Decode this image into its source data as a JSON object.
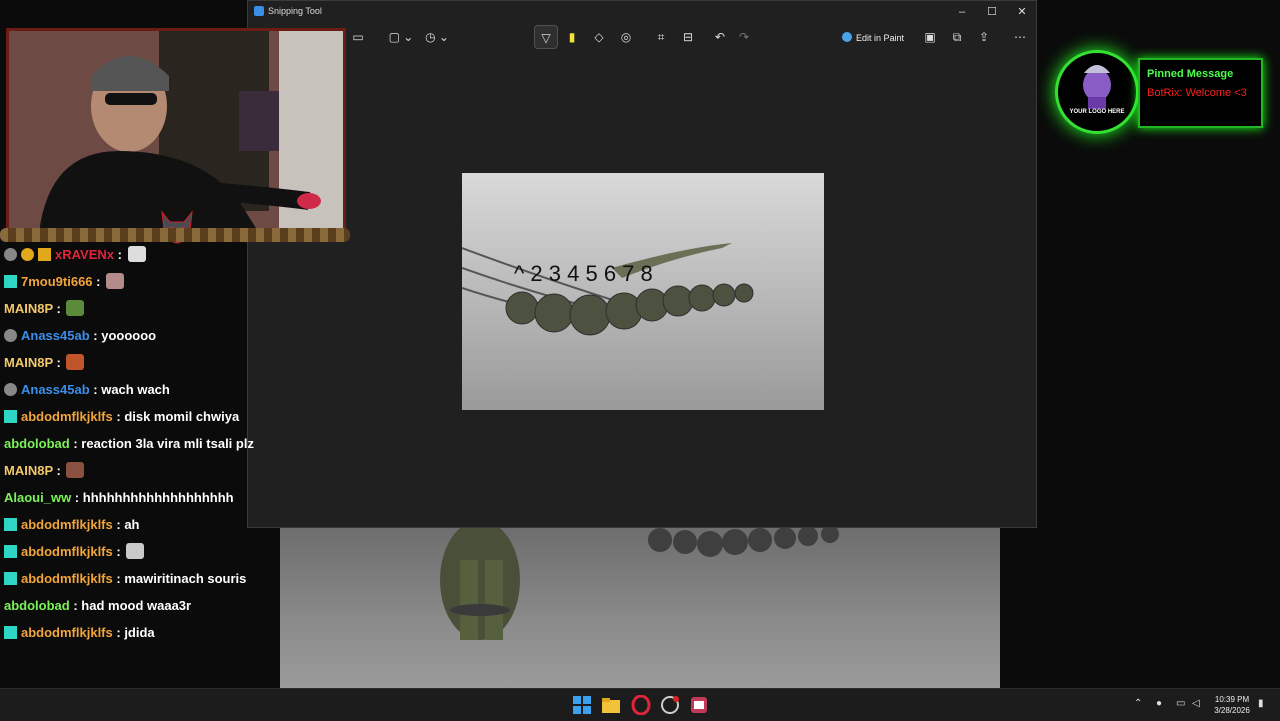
{
  "snipping_tool": {
    "title": "Snipping Tool",
    "edit_in_paint": "Edit in Paint",
    "canvas_annotation": "^ 2 3 4 5 6 7 8"
  },
  "pinned": {
    "logo_text": "YOUR LOGO HERE",
    "title": "Pinned Message",
    "text": "BotRix: Welcome <3"
  },
  "chat": {
    "messages": [
      {
        "user": "xRAVENx",
        "text": "",
        "color": "#e0243a"
      },
      {
        "user": "7mou9ti666",
        "text": "",
        "color": "#f2a53b"
      },
      {
        "user": "MAIN8P",
        "text": "",
        "color": "#f2c86b"
      },
      {
        "user": "Anass45ab",
        "text": "yoooooo",
        "color": "#3b8fe8"
      },
      {
        "user": "MAIN8P",
        "text": "",
        "color": "#f2c86b"
      },
      {
        "user": "Anass45ab",
        "text": "wach wach",
        "color": "#3b8fe8"
      },
      {
        "user": "abdodmflkjklfs",
        "text": "disk momil chwiya",
        "color": "#f2a53b"
      },
      {
        "user": "abdolobad",
        "text": "reaction 3la vira mli tsali plz",
        "color": "#7cf25a"
      },
      {
        "user": "MAIN8P",
        "text": "",
        "color": "#f2c86b"
      },
      {
        "user": "Alaoui_ww",
        "text": "hhhhhhhhhhhhhhhhhhh",
        "color": "#7cf25a"
      },
      {
        "user": "abdodmflkjklfs",
        "text": "ah",
        "color": "#f2a53b"
      },
      {
        "user": "abdodmflkjklfs",
        "text": "",
        "color": "#f2a53b"
      },
      {
        "user": "abdodmflkjklfs",
        "text": "mawiritinach souris",
        "color": "#f2a53b"
      },
      {
        "user": "abdolobad",
        "text": "had mood waaa3r",
        "color": "#7cf25a"
      },
      {
        "user": "abdodmflkjklfs",
        "text": "jdida",
        "color": "#f2a53b"
      }
    ]
  },
  "taskbar": {
    "time": "10:39 PM",
    "date": "3/28/2026"
  }
}
